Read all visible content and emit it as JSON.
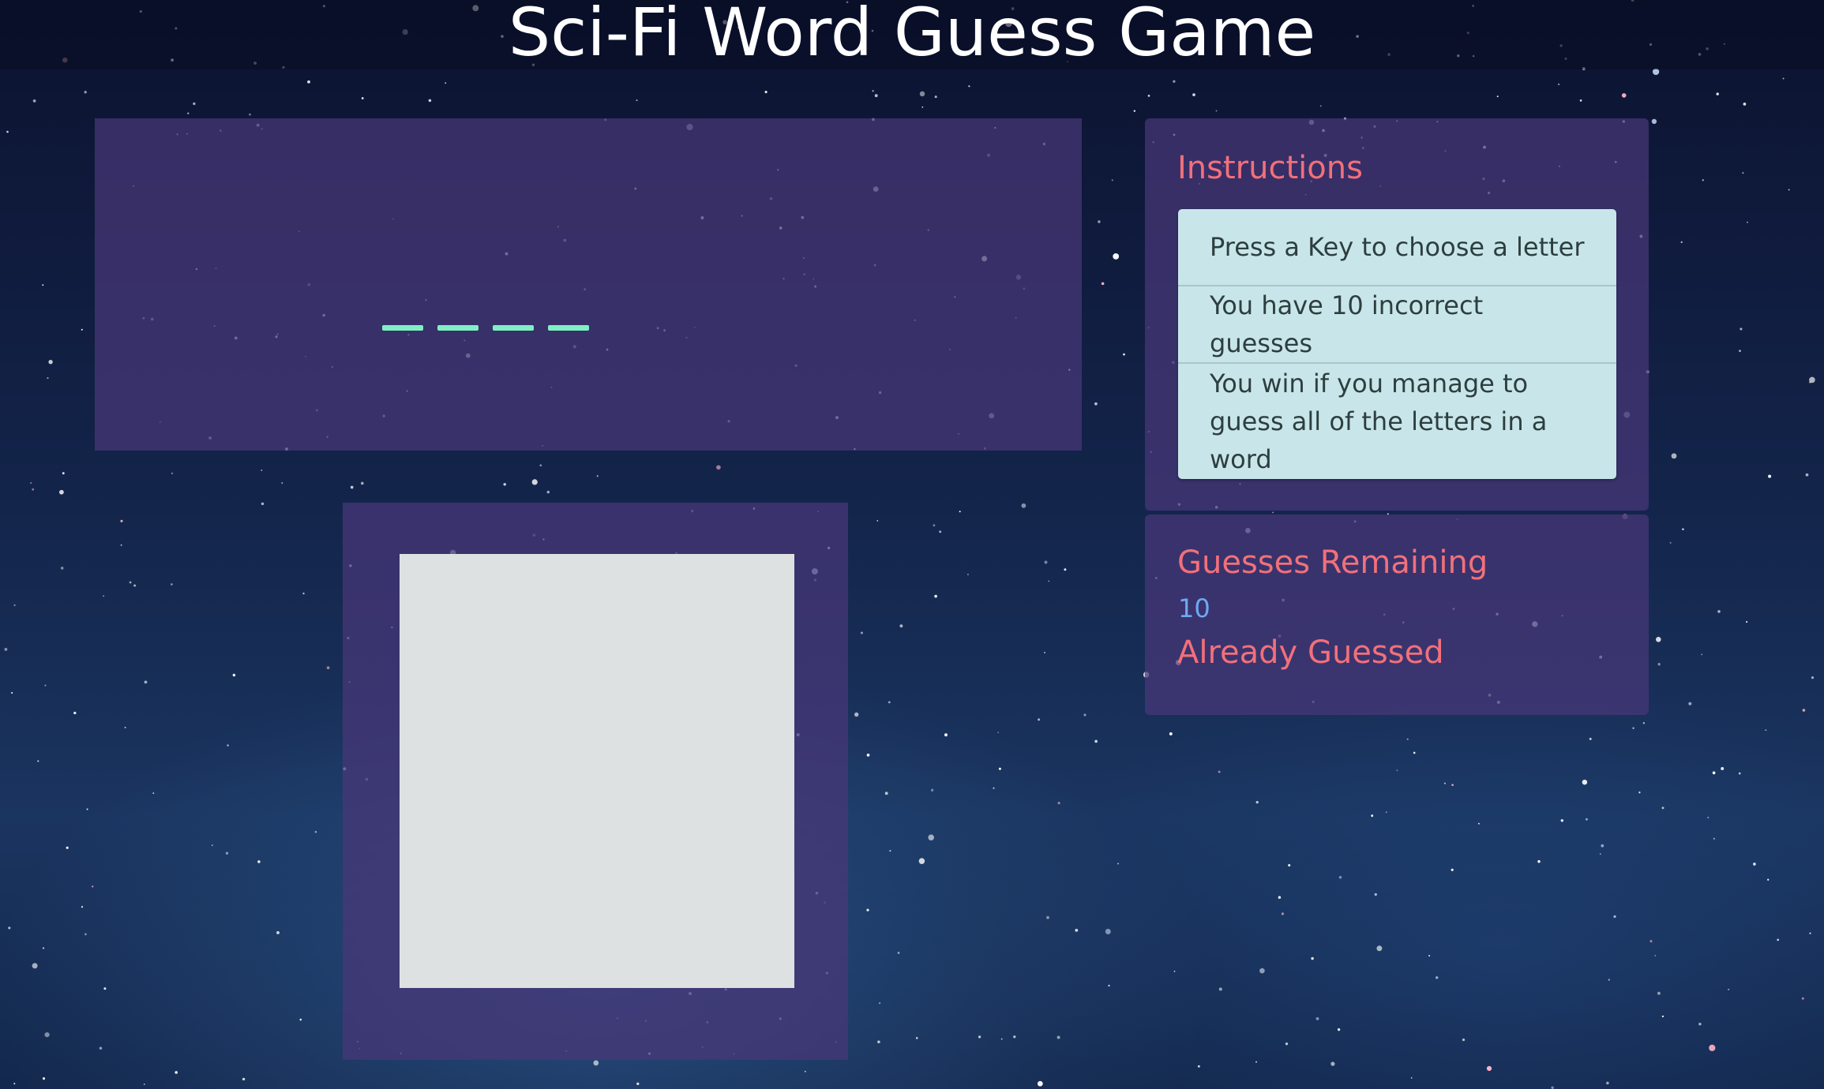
{
  "header": {
    "title": "Sci-Fi Word Guess Game"
  },
  "word": {
    "blank_count": 4,
    "blank_color": "#7ff0c4"
  },
  "instructions": {
    "heading": "Instructions",
    "items": [
      "Press a Key to choose a letter",
      "You have 10 incorrect guesses",
      "You win if you manage to guess all of the letters in a word"
    ]
  },
  "status": {
    "guesses_remaining_label": "Guesses Remaining",
    "guesses_remaining_value": "10",
    "already_guessed_label": "Already Guessed",
    "already_guessed_value": ""
  },
  "colors": {
    "heading_accent": "#f2707a",
    "value_accent": "#6fa9f2",
    "panel": "#483878",
    "instructions_list_bg": "#c8e6ea"
  }
}
